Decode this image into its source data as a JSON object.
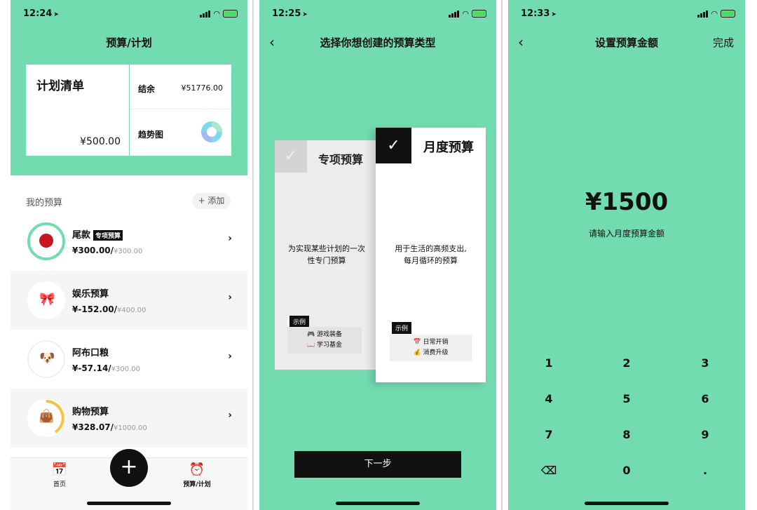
{
  "status": {
    "p1_time": "12:24",
    "p2_time": "12:25",
    "p3_time": "12:33"
  },
  "screen1": {
    "title": "预算/计划",
    "plan_card": {
      "title": "计划清单",
      "value": "¥500.00"
    },
    "balance": {
      "label": "结余",
      "value": "¥51776.00"
    },
    "trend": {
      "label": "趋势图"
    },
    "my_budget_label": "我的预算",
    "add_label": "+ 添加",
    "items": [
      {
        "name": "尾款",
        "tag": "专项预算",
        "amount": "¥300.00/",
        "limit": "¥300.00",
        "icon": "🔴"
      },
      {
        "name": "娱乐预算",
        "tag": "",
        "amount": "¥-152.00/",
        "limit": "¥400.00",
        "icon": "🎀"
      },
      {
        "name": "阿布口粮",
        "tag": "",
        "amount": "¥-57.14/",
        "limit": "¥300.00",
        "icon": "🐶"
      },
      {
        "name": "购物预算",
        "tag": "",
        "amount": "¥328.07/",
        "limit": "¥1000.00",
        "icon": "👜"
      }
    ],
    "tabs": {
      "home": "首页",
      "budget": "预算/计划",
      "fab": "+"
    },
    "colors": {
      "accent": "#72dbb0",
      "ring": "#72dbb0",
      "progress": "#f5c242"
    }
  },
  "screen2": {
    "title": "选择你想创建的预算类型",
    "card_special": {
      "title": "专项预算",
      "desc_line1": "为实现某些计划的一次",
      "desc_line2": "性专门预算",
      "example": "示例",
      "ex1": "🎮 游戏装备",
      "ex2": "📖 学习基金"
    },
    "card_monthly": {
      "title": "月度预算",
      "desc_line1": "用于生活的高频支出,",
      "desc_line2": "每月循环的预算",
      "example": "示例",
      "ex1": "📅 日常开销",
      "ex2": "💰 消费升级"
    },
    "next": "下一步"
  },
  "screen3": {
    "title": "设置预算金额",
    "done": "完成",
    "amount": "¥1500",
    "hint": "请输入月度预算金额",
    "keys": [
      "1",
      "2",
      "3",
      "4",
      "5",
      "6",
      "7",
      "8",
      "9",
      "⌫",
      "0",
      "."
    ]
  }
}
